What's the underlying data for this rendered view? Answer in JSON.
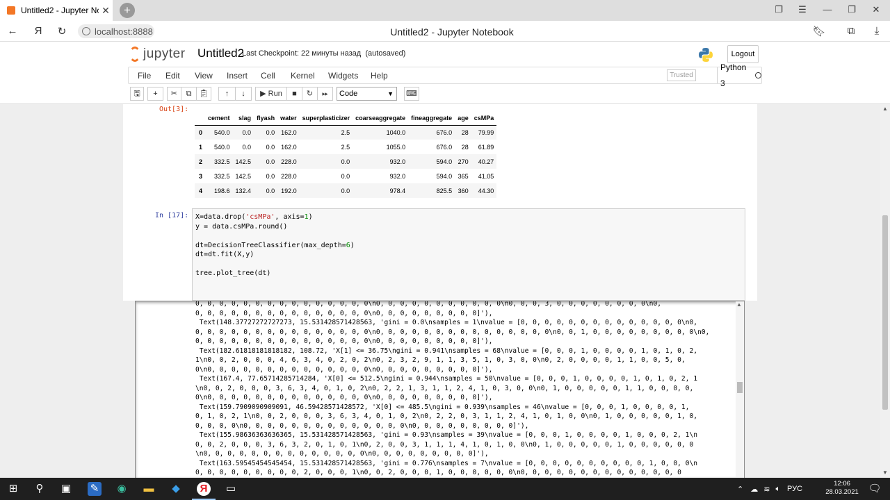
{
  "browser": {
    "tab_title": "Untitled2 - Jupyter Not",
    "tab_close": "✕",
    "new_tab": "+",
    "url": "localhost:8888",
    "page_title": "Untitled2 - Jupyter Notebook",
    "yandex_glyph": "Я"
  },
  "jupyter": {
    "logo_text": "jupyter",
    "notebook_name": "Untitled2",
    "checkpoint": "Last Checkpoint: 22 минуты назад",
    "autosaved": "(autosaved)",
    "logout_label": "Logout",
    "menus": [
      "File",
      "Edit",
      "View",
      "Insert",
      "Cell",
      "Kernel",
      "Widgets",
      "Help"
    ],
    "trusted_label": "Trusted",
    "kernel_name": "Python 3",
    "toolbar": {
      "run_label": "▶ Run",
      "cell_type": "Code"
    }
  },
  "out3": {
    "prompt": "Out[3]:",
    "columns": [
      "",
      "cement",
      "slag",
      "flyash",
      "water",
      "superplasticizer",
      "coarseaggregate",
      "fineaggregate",
      "age",
      "csMPa"
    ],
    "rows": [
      [
        "0",
        "540.0",
        "0.0",
        "0.0",
        "162.0",
        "2.5",
        "1040.0",
        "676.0",
        "28",
        "79.99"
      ],
      [
        "1",
        "540.0",
        "0.0",
        "0.0",
        "162.0",
        "2.5",
        "1055.0",
        "676.0",
        "28",
        "61.89"
      ],
      [
        "2",
        "332.5",
        "142.5",
        "0.0",
        "228.0",
        "0.0",
        "932.0",
        "594.0",
        "270",
        "40.27"
      ],
      [
        "3",
        "332.5",
        "142.5",
        "0.0",
        "228.0",
        "0.0",
        "932.0",
        "594.0",
        "365",
        "41.05"
      ],
      [
        "4",
        "198.6",
        "132.4",
        "0.0",
        "192.0",
        "0.0",
        "978.4",
        "825.5",
        "360",
        "44.30"
      ]
    ]
  },
  "in17": {
    "prompt": "In [17]:",
    "code": [
      "X=data.drop('csMPa', axis=1)",
      "y = data.csMPa.round()",
      "",
      "dt=DecisionTreeClassifier(max_depth=6)",
      "dt=dt.fit(X,y)",
      "",
      "tree.plot_tree(dt)"
    ]
  },
  "output": {
    "lines": [
      "0, 0, 0, 0, 0, 0, 0, 0, 0, 0, 0, 0, 0, 0, 0\\n0, 0, 0, 0, 0, 0, 0, 0, 0, 0, 0\\n0, 0, 0, 3, 0, 0, 0, 0, 0, 0, 0, 0\\n0,",
      "0, 0, 0, 0, 0, 0, 0, 0, 0, 0, 0, 0, 0, 0, 0\\n0, 0, 0, 0, 0, 0, 0, 0, 0]'),",
      " Text(148.37727272727273, 15.531428571428563, 'gini = 0.0\\nsamples = 1\\nvalue = [0, 0, 0, 0, 0, 0, 0, 0, 0, 0, 0, 0, 0, 0\\n0,",
      "0, 0, 0, 0, 0, 0, 0, 0, 0, 0, 0, 0, 0, 0, 0\\n0, 0, 0, 0, 0, 0, 0, 0, 0, 0, 0, 0, 0, 0, 0\\n0, 0, 1, 0, 0, 0, 0, 0, 0, 0, 0, 0\\n0,",
      "0, 0, 0, 0, 0, 0, 0, 0, 0, 0, 0, 0, 0, 0, 0\\n0, 0, 0, 0, 0, 0, 0, 0, 0]'),",
      " Text(182.61818181818182, 108.72, 'X[1] <= 36.75\\ngini = 0.941\\nsamples = 68\\nvalue = [0, 0, 0, 1, 0, 0, 0, 0, 1, 0, 1, 0, 2,",
      "1\\n0, 0, 2, 0, 0, 0, 4, 6, 3, 4, 0, 2, 0, 2\\n0, 2, 3, 2, 9, 1, 1, 3, 5, 1, 0, 3, 0, 0\\n0, 2, 0, 0, 0, 0, 1, 1, 0, 0, 5, 0,",
      "0\\n0, 0, 0, 0, 0, 0, 0, 0, 0, 0, 0, 0, 0, 0\\n0, 0, 0, 0, 0, 0, 0, 0, 0]'),",
      " Text(167.4, 77.65714285714284, 'X[0] <= 512.5\\ngini = 0.944\\nsamples = 50\\nvalue = [0, 0, 0, 1, 0, 0, 0, 0, 1, 0, 1, 0, 2, 1",
      "\\n0, 0, 2, 0, 0, 0, 3, 6, 3, 4, 0, 1, 0, 2\\n0, 2, 2, 1, 3, 1, 1, 2, 4, 1, 0, 3, 0, 0\\n0, 1, 0, 0, 0, 0, 0, 1, 1, 0, 0, 0, 0,",
      "0\\n0, 0, 0, 0, 0, 0, 0, 0, 0, 0, 0, 0, 0, 0\\n0, 0, 0, 0, 0, 0, 0, 0, 0]'),",
      " Text(159.7909090909091, 46.59428571428572, 'X[0] <= 485.5\\ngini = 0.939\\nsamples = 46\\nvalue = [0, 0, 0, 1, 0, 0, 0, 0, 1,",
      "0, 1, 0, 2, 1\\n0, 0, 2, 0, 0, 0, 3, 6, 3, 4, 0, 1, 0, 2\\n0, 2, 2, 0, 3, 1, 1, 2, 4, 1, 0, 1, 0, 0\\n0, 1, 0, 0, 0, 0, 0, 1, 0,",
      "0, 0, 0, 0\\n0, 0, 0, 0, 0, 0, 0, 0, 0, 0, 0, 0, 0, 0\\n0, 0, 0, 0, 0, 0, 0, 0, 0]'),",
      " Text(155.98636363636365, 15.531428571428563, 'gini = 0.93\\nsamples = 39\\nvalue = [0, 0, 0, 1, 0, 0, 0, 0, 1, 0, 0, 0, 2, 1\\n",
      "0, 0, 2, 0, 0, 0, 3, 6, 3, 2, 0, 1, 0, 1\\n0, 2, 0, 0, 3, 1, 1, 1, 4, 1, 0, 1, 0, 0\\n0, 1, 0, 0, 0, 0, 0, 1, 0, 0, 0, 0, 0, 0",
      "\\n0, 0, 0, 0, 0, 0, 0, 0, 0, 0, 0, 0, 0, 0\\n0, 0, 0, 0, 0, 0, 0, 0, 0]'),",
      " Text(163.59545454545454, 15.531428571428563, 'gini = 0.776\\nsamples = 7\\nvalue = [0, 0, 0, 0, 0, 0, 0, 0, 0, 0, 1, 0, 0, 0\\n",
      "0, 0, 0, 0, 0, 0, 0, 0, 0, 2, 0, 0, 0, 1\\n0, 0, 2, 0, 0, 0, 1, 0, 0, 0, 0, 0, 0\\n0, 0, 0, 0, 0, 0, 0, 0, 0, 0, 0, 0, 0, 0"
    ]
  },
  "taskbar": {
    "language": "РУС",
    "time": "12:06",
    "date": "28.03.2021"
  }
}
